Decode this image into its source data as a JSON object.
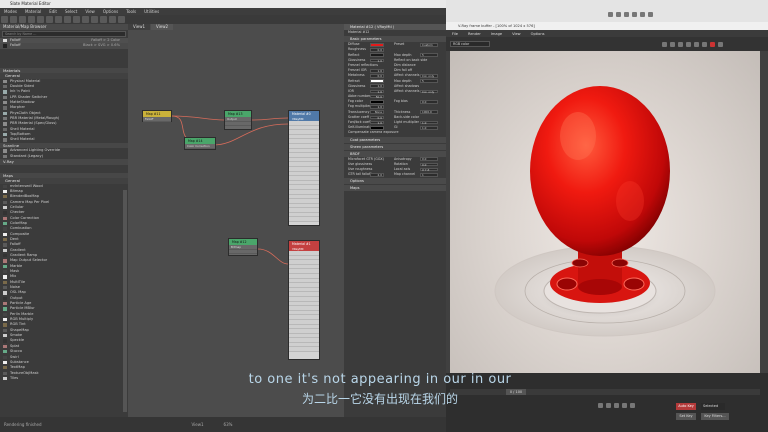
{
  "slate": {
    "title": "Slate Material Editor",
    "menu": [
      "Modes",
      "Material",
      "Edit",
      "Select",
      "View",
      "Options",
      "Tools",
      "Utilities"
    ],
    "browser_title": "Material/Map Browser",
    "search_placeholder": "Search by Name ...",
    "scene_items": [
      {
        "label": "Falloff",
        "value": "Falloff > 2 Color"
      },
      {
        "label": "Falloff",
        "value": "Black > SVG > 0.6%"
      }
    ],
    "categories": [
      {
        "name": "Materials",
        "sub": "General",
        "items": [
          "Physical Material",
          "Double Sided",
          "Ink 'n Paint",
          "LPR Shader Switcher",
          "MatteShadow",
          "Morpher",
          "PhysCloth Object",
          "PBR Material (Metal/Rough)",
          "PBR Material (Spec/Gloss)",
          "Shell Material",
          "Top/Bottom",
          "Shell Material"
        ]
      },
      {
        "name": "Scanline",
        "items": [
          "Advanced Lighting Override",
          "Standard (Legacy)"
        ]
      },
      {
        "name": "V-Ray"
      },
      {
        "name": "Maps",
        "sub": "General",
        "items": [
          "mrIntensedl Wood",
          "Bitmap",
          "BlendedBoxMap",
          "Camera Map Per Pixel",
          "Cellular",
          "Checker",
          "Color Correction",
          "ColorMap",
          "Combustion",
          "Composite",
          "Dent",
          "Falloff",
          "Gradient",
          "Gradient Ramp",
          "Map Output Selector",
          "Marble",
          "Mask",
          "Mix",
          "MultiTile",
          "Noise",
          "OSL Map",
          "Output",
          "Particle Age",
          "Particle MBlur",
          "Perlin Marble",
          "RGB Multiply",
          "RGB Tint",
          "ShapeMap",
          "Smoke",
          "Speckle",
          "Splat",
          "Stucco",
          "Swirl",
          "Substance",
          "TextMap",
          "TextureObjMask",
          "Tiles"
        ]
      }
    ],
    "views": [
      "View1",
      "View2"
    ],
    "status": "Rendering finished",
    "nav_label": "View1",
    "zoom": "63%"
  },
  "nodes": {
    "n1": {
      "title": "Map #11",
      "sub": "Falloff"
    },
    "n2": {
      "title": "Map #13",
      "sub": "Output"
    },
    "n3": {
      "title": "Map #14",
      "sub": "Color Correction"
    },
    "n4": {
      "title": "Map #12",
      "sub": "Bitmap"
    },
    "big1": {
      "title": "Material #0",
      "sub": "VRayMtl"
    },
    "big2": {
      "title": "Material #1",
      "sub": "VRayMtl"
    }
  },
  "props": {
    "header": "Material #12 ( VRayMtl )",
    "sub": "Material #12",
    "basic": "Basic parameters",
    "rows": [
      {
        "label": "Diffuse",
        "right": "Preset",
        "rval": "Custom"
      },
      {
        "label": "Roughness",
        "val": "0.0"
      },
      {
        "label": "Reflect",
        "right": "Max depth",
        "rval": "5"
      },
      {
        "label": "Glossiness",
        "val": "1.0",
        "right": "Reflect on back side"
      },
      {
        "label": "Fresnel reflections",
        "right": "Dim distance"
      },
      {
        "label": "Fresnel IOR",
        "val": "1.6",
        "right": "Dim fall off"
      },
      {
        "label": "Metalness",
        "val": "0.0",
        "right": "Affect channels",
        "rval": "Col. only"
      },
      {
        "label": "Refract",
        "right": "Max depth",
        "rval": "5"
      },
      {
        "label": "Glossiness",
        "val": "1.0",
        "right": "Affect shadows"
      },
      {
        "label": "IOR",
        "val": "1.6",
        "right": "Affect channels",
        "rval": "Col. only"
      },
      {
        "label": "Abbe number",
        "val": "50.0"
      },
      {
        "label": "Fog color",
        "right": "Fog bias",
        "rval": "0.0"
      },
      {
        "label": "Fog multiplier",
        "val": "1.0"
      },
      {
        "label": "Translucency",
        "val": "None",
        "right": "Thickness",
        "rval": "1000.0"
      },
      {
        "label": "Scatter coeff",
        "val": "0.0",
        "right": "Back-side color"
      },
      {
        "label": "Fwd/bck coeff",
        "val": "1.0",
        "right": "Light multiplier",
        "rval": "1.0"
      },
      {
        "label": "Self-illumination",
        "right": "GI",
        "rval": "1.0"
      },
      {
        "label": "Compensate camera exposure"
      }
    ],
    "sections": [
      "Coat parameters",
      "Sheen parameters",
      "BRDF"
    ],
    "brdf_rows": [
      {
        "label": "Microfacet GTR (GGX)",
        "right": "Anisotropy",
        "rval": "0.0"
      },
      {
        "label": "Use glossiness",
        "right": "Rotation",
        "rval": "0.0"
      },
      {
        "label": "Use roughness",
        "right": "Local axis",
        "rval": "X Y Z"
      },
      {
        "label": "GTR tail falloff",
        "val": "2.0",
        "right": "Map channel",
        "rval": "1"
      }
    ],
    "more": [
      "Options",
      "Maps"
    ]
  },
  "frame_buffer": {
    "title": "V-Ray frame buffer - [100% of 1024 x 576]",
    "menu": [
      "File",
      "Render",
      "Image",
      "View",
      "Options"
    ],
    "channel": "RGB color"
  },
  "subtitles": {
    "en": "to one it's not appearing in our in our",
    "zh": "为二比一它没有出现在我们的"
  },
  "timeline": {
    "frame": "0 / 100",
    "auto_key": "Auto Key",
    "selected": "Selected",
    "set_key": "Set Key",
    "key_filters": "Key Filters..."
  },
  "colors": {
    "diffuse": "#e31b1b",
    "refract": "#ffffff",
    "fog": "#000000",
    "node_yellow": "#c9b13a",
    "node_green": "#4aa66a",
    "node_blue": "#5079a8",
    "node_red": "#c44040"
  }
}
